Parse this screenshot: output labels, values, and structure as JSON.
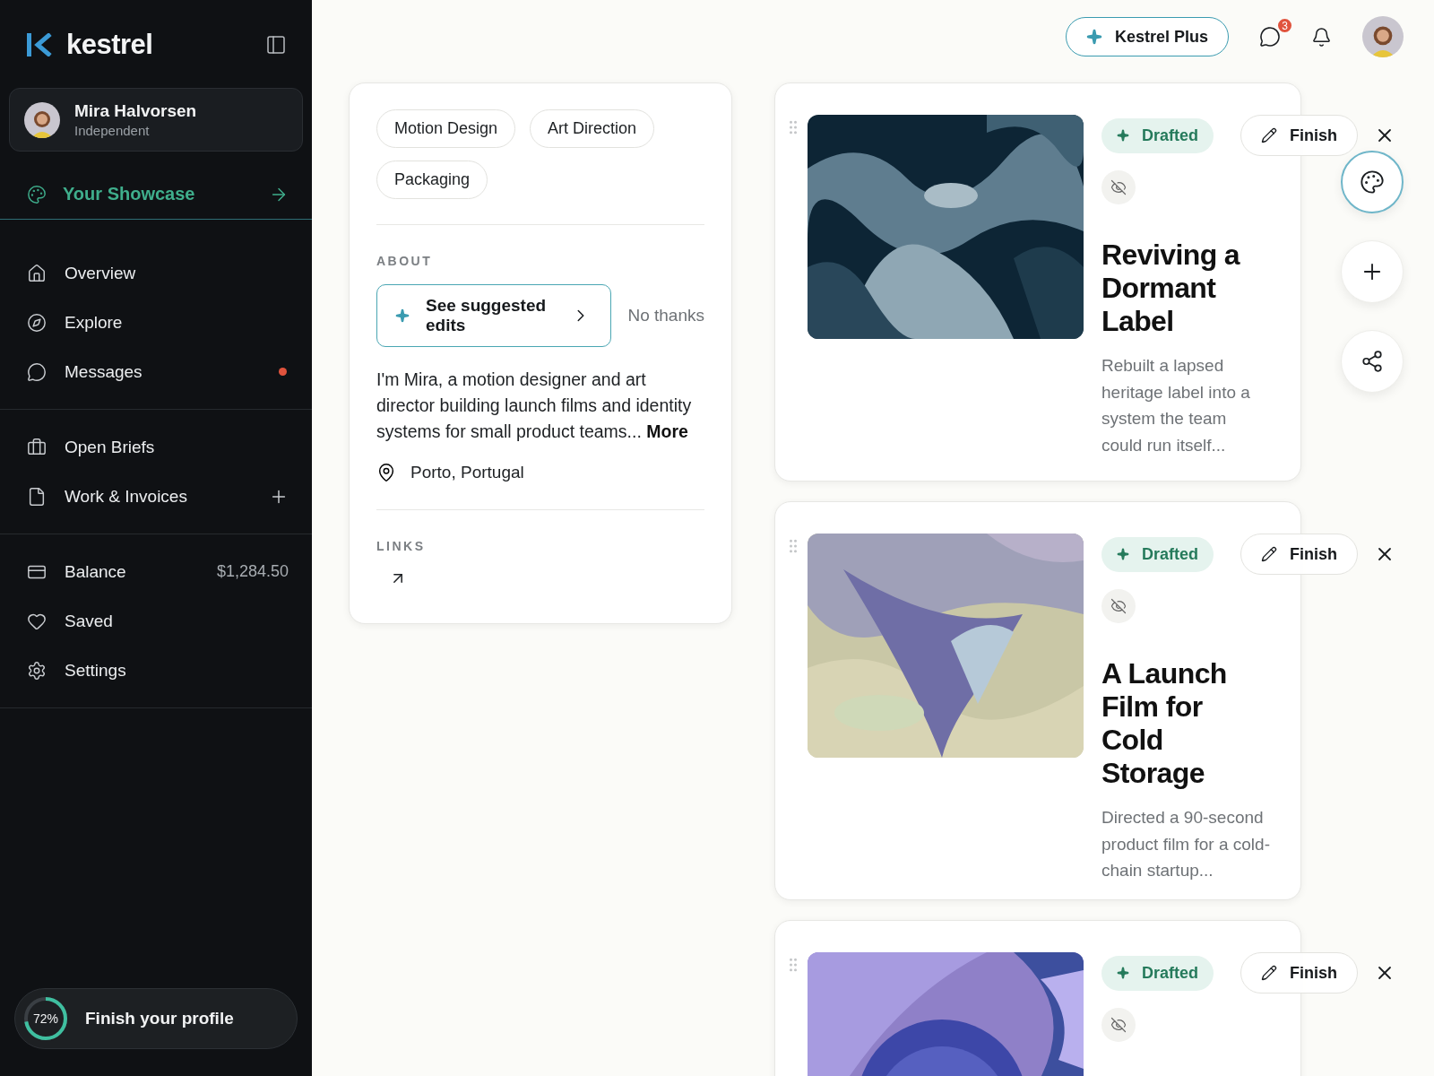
{
  "brand": {
    "name": "kestrel"
  },
  "user": {
    "name": "Mira Halvorsen",
    "role": "Independent"
  },
  "showcase": {
    "label": "Your Showcase",
    "selected": true
  },
  "nav_groups": [
    [
      {
        "kind": "home",
        "label": "Overview",
        "unread": false,
        "addable": false
      },
      {
        "kind": "compass",
        "label": "Explore",
        "unread": false,
        "addable": false
      },
      {
        "kind": "chat",
        "label": "Messages",
        "unread": true,
        "addable": false
      }
    ],
    [
      {
        "kind": "briefcase",
        "label": "Open Briefs",
        "unread": false,
        "addable": false
      },
      {
        "kind": "file",
        "label": "Work & Invoices",
        "unread": false,
        "addable": true
      }
    ],
    [
      {
        "kind": "card",
        "label": "Balance",
        "value": "$1,284.50",
        "unread": false,
        "addable": false
      },
      {
        "kind": "heart",
        "label": "Saved",
        "unread": false,
        "addable": false
      },
      {
        "kind": "gear",
        "label": "Settings",
        "unread": false,
        "addable": false
      }
    ]
  ],
  "profile_progress": {
    "level": 0.72,
    "reading": "72%",
    "label": "Finish your profile"
  },
  "topbar": {
    "upgrade": "Kestrel Plus",
    "messages_count": "3"
  },
  "profile": {
    "tags": [
      "Motion Design",
      "Art Direction",
      "Packaging"
    ],
    "about_heading": "ABOUT",
    "suggest": "See suggested edits",
    "dismiss": "No thanks",
    "bio": "I'm Mira, a motion designer and art director building launch films and identity systems for small product teams...",
    "more": "More",
    "location": "Porto, Portugal",
    "links_heading": "LINKS"
  },
  "projects": [
    {
      "status": "Drafted",
      "finish": "Finish",
      "title": "Reviving a Dormant Label",
      "description": "Rebuilt a lapsed heritage label into a system the team could run itself..."
    },
    {
      "status": "Drafted",
      "finish": "Finish",
      "title": "A Launch Film for Cold Storage",
      "description": "Directed a 90-second product film for a cold-chain startup..."
    },
    {
      "status": "Drafted",
      "finish": "Finish"
    }
  ],
  "fab": [
    {
      "kind": "palette",
      "selected": true
    },
    {
      "kind": "add",
      "selected": false
    },
    {
      "kind": "share",
      "selected": false
    }
  ]
}
